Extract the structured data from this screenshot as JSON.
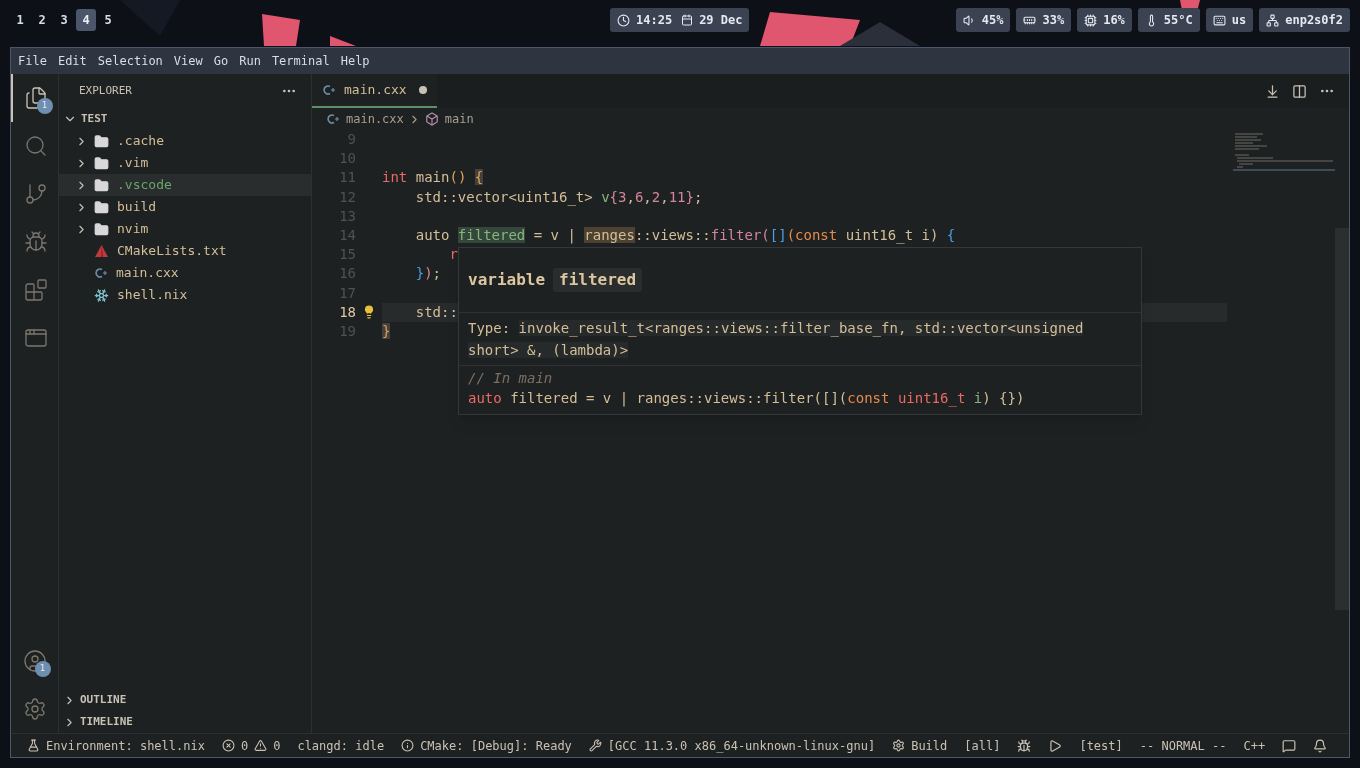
{
  "top_bar": {
    "workspaces": [
      {
        "label": "1",
        "selected": false
      },
      {
        "label": "2",
        "selected": false
      },
      {
        "label": "3",
        "selected": false
      },
      {
        "label": "4",
        "selected": true
      },
      {
        "label": "5",
        "selected": false
      }
    ],
    "clock": {
      "time": "14:25",
      "date": "29 Dec"
    },
    "indicators": [
      {
        "kind": "volume",
        "text": "45%"
      },
      {
        "kind": "memory",
        "text": "33%"
      },
      {
        "kind": "cpu",
        "text": "16%"
      },
      {
        "kind": "temperature",
        "text": "55°C"
      },
      {
        "kind": "keyboard",
        "text": "us"
      },
      {
        "kind": "network",
        "text": "enp2s0f2"
      }
    ]
  },
  "menu": [
    "File",
    "Edit",
    "Selection",
    "View",
    "Go",
    "Run",
    "Terminal",
    "Help"
  ],
  "activity_bar": {
    "items": [
      {
        "kind": "explorer",
        "selected": true,
        "badge": "1"
      },
      {
        "kind": "search",
        "selected": false
      },
      {
        "kind": "source-control",
        "selected": false
      },
      {
        "kind": "run-debug",
        "selected": false
      },
      {
        "kind": "extensions",
        "selected": false
      },
      {
        "kind": "remote",
        "selected": false
      }
    ],
    "bottom": [
      {
        "kind": "account",
        "badge": "1"
      },
      {
        "kind": "settings"
      }
    ]
  },
  "explorer": {
    "title": "EXPLORER",
    "root": {
      "label": "TEST",
      "expanded": true,
      "children": [
        {
          "name": ".cache",
          "kind": "folder",
          "expanded": false,
          "selected": false,
          "untracked": false
        },
        {
          "name": ".vim",
          "kind": "folder",
          "expanded": false,
          "selected": false,
          "untracked": false
        },
        {
          "name": ".vscode",
          "kind": "folder",
          "expanded": false,
          "selected": true,
          "untracked": true
        },
        {
          "name": "build",
          "kind": "folder",
          "expanded": false,
          "selected": false,
          "untracked": false
        },
        {
          "name": "nvim",
          "kind": "folder",
          "expanded": false,
          "selected": false,
          "untracked": false
        },
        {
          "name": "CMakeLists.txt",
          "kind": "cmake",
          "selected": false,
          "untracked": false
        },
        {
          "name": "main.cxx",
          "kind": "cpp",
          "selected": false,
          "untracked": false
        },
        {
          "name": "shell.nix",
          "kind": "nix",
          "selected": false,
          "untracked": false
        }
      ]
    },
    "sections": [
      {
        "label": "OUTLINE",
        "expanded": false
      },
      {
        "label": "TIMELINE",
        "expanded": false
      }
    ]
  },
  "editor": {
    "tabs": [
      {
        "label": "main.cxx",
        "selected": true,
        "modified": true
      }
    ],
    "breadcrumb": [
      {
        "kind": "file",
        "text": "main.cxx"
      },
      {
        "kind": "function",
        "text": "main"
      }
    ],
    "lines": [
      {
        "number": "9",
        "current": false,
        "lightbulb": false
      },
      {
        "number": "10",
        "current": false,
        "lightbulb": false
      },
      {
        "number": "11",
        "current": false,
        "lightbulb": false,
        "tokens": [
          {
            "kind": "kw",
            "text": "int"
          },
          {
            "kind": "plain",
            "text": " main"
          },
          {
            "kind": "b1",
            "text": "() "
          },
          {
            "kind": "match",
            "text": "{"
          }
        ]
      },
      {
        "number": "12",
        "current": false,
        "lightbulb": false,
        "tokens": [
          {
            "kind": "plain",
            "text": "    std::vector<uint16_t> "
          },
          {
            "kind": "var",
            "text": "v"
          },
          {
            "kind": "b2",
            "text": "{"
          },
          {
            "kind": "num",
            "text": "3"
          },
          {
            "kind": "plain",
            "text": ","
          },
          {
            "kind": "num",
            "text": "6"
          },
          {
            "kind": "plain",
            "text": ","
          },
          {
            "kind": "num",
            "text": "2"
          },
          {
            "kind": "plain",
            "text": ","
          },
          {
            "kind": "num",
            "text": "11"
          },
          {
            "kind": "b2",
            "text": "}"
          },
          {
            "kind": "plain",
            "text": ";"
          }
        ]
      },
      {
        "number": "13",
        "current": false,
        "lightbulb": false
      },
      {
        "number": "14",
        "current": false,
        "lightbulb": false,
        "tokens": [
          {
            "kind": "plain",
            "text": "    auto "
          },
          {
            "kind": "write",
            "text": "filtered"
          },
          {
            "kind": "plain",
            "text": " = v | "
          },
          {
            "kind": "read",
            "text": "ranges"
          },
          {
            "kind": "plain",
            "text": "::views::"
          },
          {
            "kind": "fn",
            "text": "filter"
          },
          {
            "kind": "b2",
            "text": "("
          },
          {
            "kind": "b3",
            "text": "[]"
          },
          {
            "kind": "storage",
            "text": "(const"
          },
          {
            "kind": "plain",
            "text": " uint16_t i) "
          },
          {
            "kind": "b3",
            "text": "{"
          }
        ]
      },
      {
        "number": "15",
        "current": false,
        "lightbulb": false,
        "tokens": [
          {
            "kind": "kw",
            "text": "        r"
          }
        ]
      },
      {
        "number": "16",
        "current": false,
        "lightbulb": false,
        "tokens": [
          {
            "kind": "b3",
            "text": "    }"
          },
          {
            "kind": "b2",
            "text": ")"
          },
          {
            "kind": "plain",
            "text": ";"
          }
        ]
      },
      {
        "number": "17",
        "current": false,
        "lightbulb": false
      },
      {
        "number": "18",
        "current": true,
        "lightbulb": true,
        "tokens": [
          {
            "kind": "plain",
            "text": "    std::"
          }
        ]
      },
      {
        "number": "19",
        "current": false,
        "lightbulb": false,
        "tokens": [
          {
            "kind": "match",
            "text": "}"
          }
        ]
      }
    ],
    "hover": {
      "title_kind": "variable",
      "title_name": "filtered",
      "type_label": "Type:",
      "type_text": "invoke_result_t<ranges::views::filter_base_fn, std::vector<unsigned short> &, (lambda)>",
      "comment": "// In main",
      "code": [
        {
          "kind": "kw",
          "text": "auto"
        },
        {
          "kind": "plain",
          "text": " filtered = v | ranges::views::filter([]("
        },
        {
          "kind": "storage",
          "text": "const"
        },
        {
          "kind": "kw",
          "text": " uint16_t"
        },
        {
          "kind": "var",
          "text": " i"
        },
        {
          "kind": "plain",
          "text": ") {})"
        }
      ]
    }
  },
  "status_bar": [
    {
      "kind": "flask",
      "text": "Environment: shell.nix"
    },
    {
      "kind": "problems",
      "errors": "0",
      "warnings": "0"
    },
    {
      "kind": "text",
      "text": "clangd: idle"
    },
    {
      "kind": "info",
      "text": "CMake: [Debug]: Ready"
    },
    {
      "kind": "tools",
      "text": "[GCC 11.3.0 x86_64-unknown-linux-gnu]"
    },
    {
      "kind": "gear",
      "text": "Build"
    },
    {
      "kind": "text",
      "text": "[all]"
    },
    {
      "kind": "bug"
    },
    {
      "kind": "play"
    },
    {
      "kind": "text",
      "text": "[test]"
    },
    {
      "kind": "text",
      "text": "-- NORMAL --"
    },
    {
      "kind": "text",
      "text": "C++"
    },
    {
      "kind": "feedback"
    },
    {
      "kind": "bell"
    }
  ]
}
